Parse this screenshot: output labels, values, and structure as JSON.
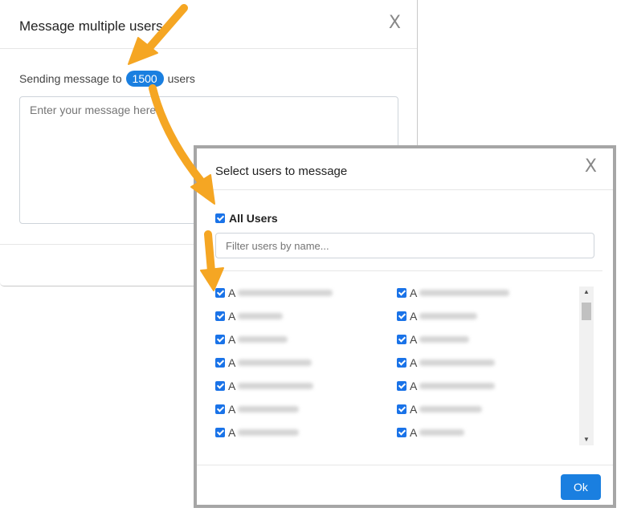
{
  "back_modal": {
    "title": "Message multiple users",
    "close_glyph": "X",
    "sending_prefix": "Sending message to",
    "user_count": "1500",
    "sending_suffix": "users",
    "message_placeholder": "Enter your message here"
  },
  "front_modal": {
    "title": "Select users to message",
    "close_glyph": "X",
    "all_users_label": "All Users",
    "filter_placeholder": "Filter users by name...",
    "ok_label": "Ok",
    "users_left": [
      {
        "initial": "A",
        "checked": true
      },
      {
        "initial": "A",
        "checked": true
      },
      {
        "initial": "A",
        "checked": true
      },
      {
        "initial": "A",
        "checked": true
      },
      {
        "initial": "A",
        "checked": true
      },
      {
        "initial": "A",
        "checked": true
      },
      {
        "initial": "A",
        "checked": true
      }
    ],
    "users_right": [
      {
        "initial": "A",
        "checked": true
      },
      {
        "initial": "A",
        "checked": true
      },
      {
        "initial": "A",
        "checked": true
      },
      {
        "initial": "A",
        "checked": true
      },
      {
        "initial": "A",
        "checked": true
      },
      {
        "initial": "A",
        "checked": true
      },
      {
        "initial": "A",
        "checked": true
      }
    ]
  },
  "colors": {
    "accent": "#1a7fe0",
    "annotation_arrow": "#f5a623"
  },
  "icons": {
    "close": "close-icon",
    "checkbox": "checkbox-checked-icon",
    "scroll_up": "scroll-up-arrow-icon",
    "scroll_down": "scroll-down-arrow-icon",
    "annotation": "annotation-arrow-icon"
  }
}
